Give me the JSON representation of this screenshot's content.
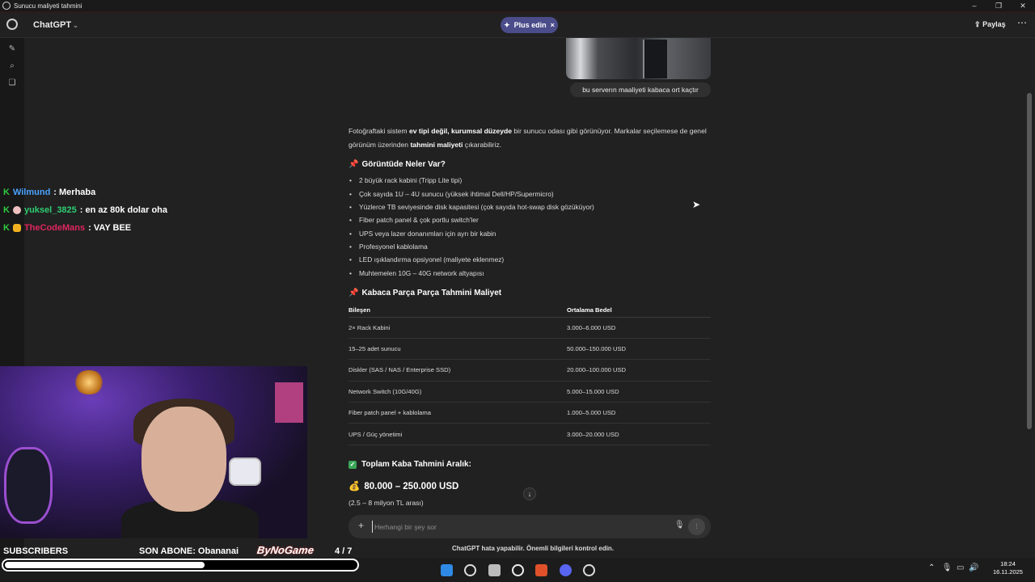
{
  "window": {
    "title": "Sunucu maliyeti tahmini"
  },
  "header": {
    "model": "ChatGPT",
    "plus_label": "Plus edin",
    "share_label": "Paylaş"
  },
  "user_message": "bu serverın maaliyeti kabaca ort kaçtır",
  "answer": {
    "intro_p1": "Fotoğraftaki sistem ",
    "intro_b1": "ev tipi değil, kurumsal düzeyde",
    "intro_p2": " bir sunucu odası gibi görünüyor. Markalar seçilemese de genel görünüm üzerinden ",
    "intro_b2": "tahmini maliyeti",
    "intro_p3": " çıkarabiliriz.",
    "section1_title": "Görüntüde Neler Var?",
    "items": [
      "2 büyük rack kabini (Tripp Lite tipi)",
      "Çok sayıda 1U – 4U sunucu (yüksek ihtimal Dell/HP/Supermicro)",
      "Yüzlerce TB seviyesinde disk kapasitesi (çok sayıda hot-swap disk gözüküyor)",
      "Fiber patch panel & çok portlu switch'ler",
      "UPS veya lazer donanımları için ayrı bir kabin",
      "Profesyonel kablolama",
      "LED ışıklandırma opsiyonel (maliyete eklenmez)",
      "Muhtemelen 10G – 40G network altyapısı"
    ],
    "section2_title": "Kabaca Parça Parça Tahmini Maliyet",
    "table": {
      "headers": [
        "Bileşen",
        "Ortalama Bedel"
      ],
      "rows": [
        [
          "2× Rack Kabini",
          "3.000–6.000 USD"
        ],
        [
          "15–25 adet sunucu",
          "50.000–150.000 USD"
        ],
        [
          "Diskler (SAS / NAS / Enterprise SSD)",
          "20.000–100.000 USD"
        ],
        [
          "Network Switch (10G/40G)",
          "5.000–15.000 USD"
        ],
        [
          "Fiber patch panel + kablolama",
          "1.000–5.000 USD"
        ],
        [
          "UPS / Güç yönetimi",
          "3.000–20.000 USD"
        ]
      ]
    },
    "total_title": "Toplam Kaba Tahmini Aralık:",
    "total_value": "80.000 – 250.000 USD",
    "total_tl": "(2.5 – 8 milyon TL arası)"
  },
  "composer": {
    "placeholder": "Herhangi bir şey sor"
  },
  "disclaimer": "ChatGPT hata yapabilir. Önemli bilgileri kontrol edin.",
  "stream": {
    "chat": [
      {
        "user": "Wilmund",
        "message": ": Merhaba",
        "color": "#4aa3ff"
      },
      {
        "user": "yuksel_3825",
        "message": ": en az 80k dolar oha",
        "color": "#2ecc71"
      },
      {
        "user": "TheCodeMans",
        "message": ": VAY BEE",
        "color": "#e0245e"
      }
    ],
    "subscribers_label": "SUBSCRIBERS",
    "last_sub": "SON ABONE: Obananai",
    "sponsor": "ByNoGame",
    "sub_count": "4 / 7",
    "sub_progress": 0.57
  },
  "taskbar": {
    "time": "18:24",
    "date": "16.11.2025"
  }
}
